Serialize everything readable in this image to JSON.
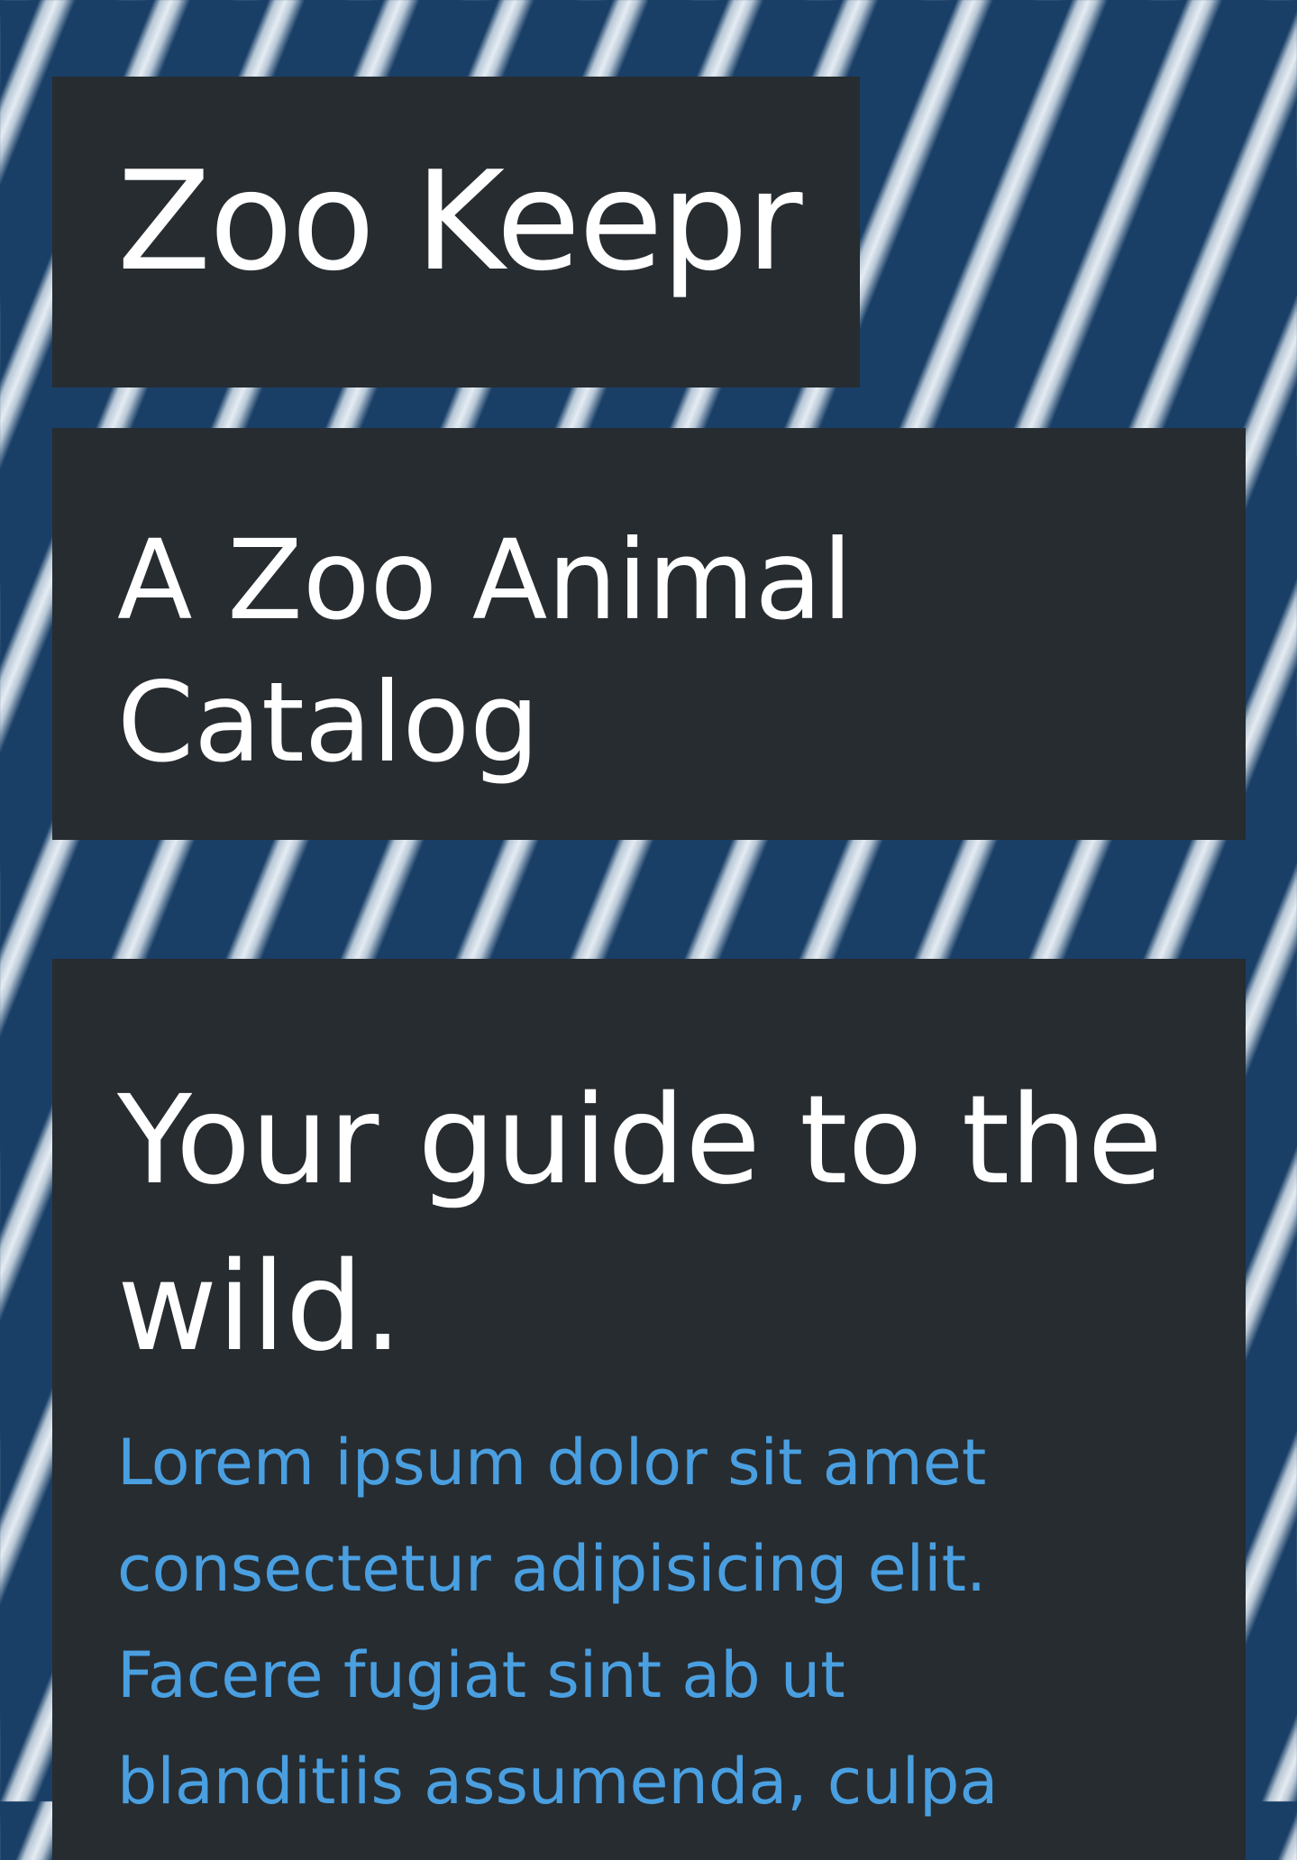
{
  "brand": {
    "title": "Zoo Keepr"
  },
  "subtitle": {
    "text": "A Zoo Animal Catalog"
  },
  "hero": {
    "heading": "Your guide to the wild.",
    "body": "Lorem ipsum dolor sit amet consectetur adipisicing elit. Facere fugiat sint ab ut blanditiis assumenda, culpa"
  },
  "colors": {
    "panel_background": "#272c30",
    "accent_text": "#4a9fe0",
    "background": "#1a3f66"
  },
  "background_image": "zebra-stripes-pattern"
}
